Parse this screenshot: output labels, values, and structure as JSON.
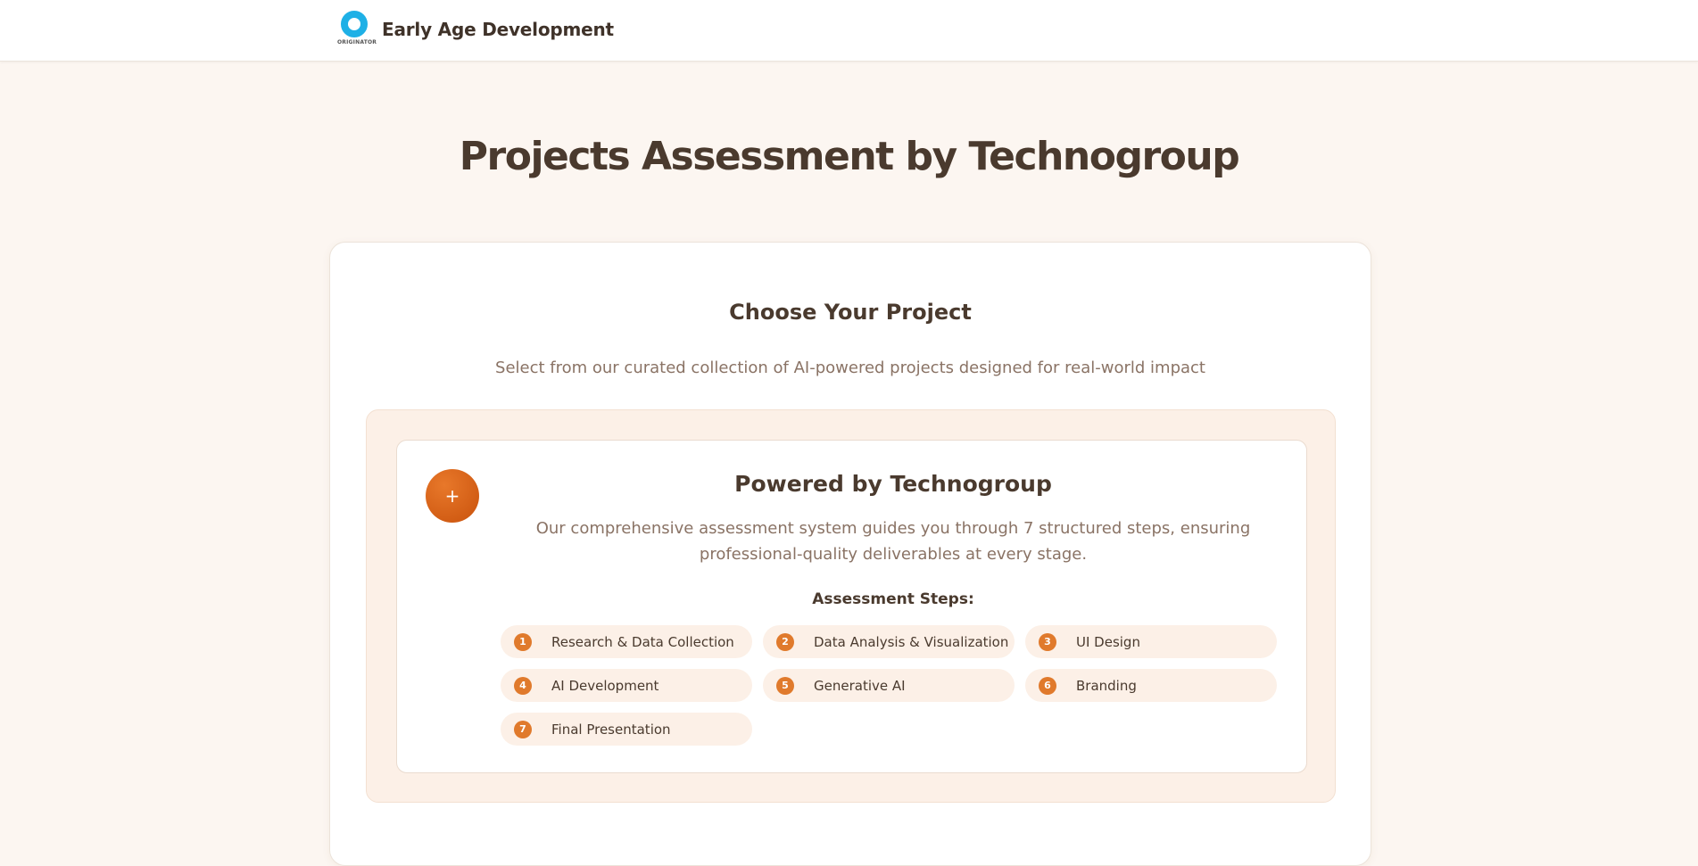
{
  "header": {
    "logo_text": "ORIGINATOR",
    "brand_name": "Early Age Development"
  },
  "hero": {
    "title": "Projects Assessment by Technogroup"
  },
  "card": {
    "title": "Choose Your Project",
    "subtitle": "Select from our curated collection of AI-powered projects designed for real-world impact"
  },
  "powered": {
    "icon": "sparkle-icon",
    "icon_glyph": "+",
    "title": "Powered by Technogroup",
    "description": "Our comprehensive assessment system guides you through 7 structured steps, ensuring professional-quality deliverables at every stage.",
    "steps_title": "Assessment Steps:",
    "steps": [
      {
        "num": "1",
        "label": "Research & Data Collection"
      },
      {
        "num": "2",
        "label": "Data Analysis & Visualization"
      },
      {
        "num": "3",
        "label": "UI Design"
      },
      {
        "num": "4",
        "label": "AI Development"
      },
      {
        "num": "5",
        "label": "Generative AI"
      },
      {
        "num": "6",
        "label": "Branding"
      },
      {
        "num": "7",
        "label": "Final Presentation"
      }
    ]
  },
  "colors": {
    "accent": "#e07a2c",
    "page_bg": "#fcf6f1",
    "logo_blue": "#1eb0e6"
  }
}
